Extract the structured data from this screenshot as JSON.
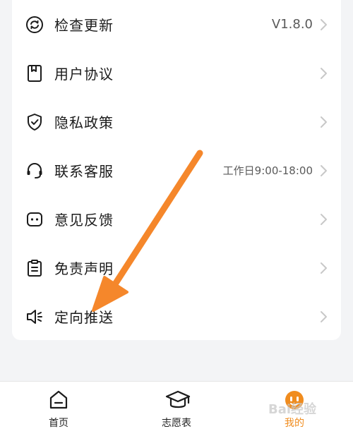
{
  "settings": {
    "items": [
      {
        "label": "检查更新",
        "value": "V1.8.0",
        "icon": "refresh-icon"
      },
      {
        "label": "用户协议",
        "value": "",
        "icon": "bookmark-icon"
      },
      {
        "label": "隐私政策",
        "value": "",
        "icon": "shield-check-icon"
      },
      {
        "label": "联系客服",
        "value": "工作日9:00-18:00",
        "icon": "headset-icon"
      },
      {
        "label": "意见反馈",
        "value": "",
        "icon": "feedback-icon"
      },
      {
        "label": "免责声明",
        "value": "",
        "icon": "clipboard-icon"
      },
      {
        "label": "定向推送",
        "value": "",
        "icon": "speaker-icon"
      }
    ]
  },
  "tabbar": {
    "tabs": [
      {
        "label": "首页",
        "icon": "home-icon",
        "active": false
      },
      {
        "label": "志愿表",
        "icon": "graduation-cap-icon",
        "active": false
      },
      {
        "label": "我的",
        "icon": "profile-face-icon",
        "active": true
      }
    ]
  },
  "colors": {
    "accent": "#f08c1e",
    "annotation_arrow": "#f5872b",
    "background": "#f3f4f6",
    "card": "#ffffff"
  },
  "watermark": "Bai经验"
}
